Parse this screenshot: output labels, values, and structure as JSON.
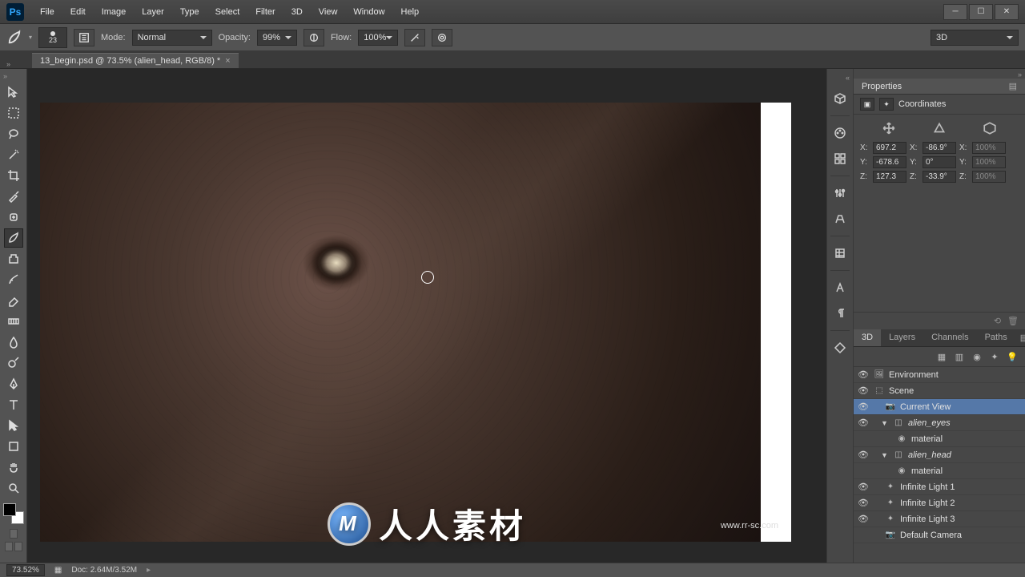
{
  "menubar": [
    "File",
    "Edit",
    "Image",
    "Layer",
    "Type",
    "Select",
    "Filter",
    "3D",
    "View",
    "Window",
    "Help"
  ],
  "logo_text": "Ps",
  "doctab": {
    "title": "13_begin.psd @ 73.5% (alien_head, RGB/8) *"
  },
  "options": {
    "brush_size": "23",
    "mode_label": "Mode:",
    "mode_value": "Normal",
    "opacity_label": "Opacity:",
    "opacity_value": "99%",
    "flow_label": "Flow:",
    "flow_value": "100%",
    "workspace": "3D"
  },
  "properties": {
    "title": "Properties",
    "subtitle": "Coordinates",
    "rows": [
      {
        "l1": "X:",
        "v1": "697.2",
        "l2": "X:",
        "v2": "-86.9°",
        "l3": "X:",
        "v3": "100%"
      },
      {
        "l1": "Y:",
        "v1": "-678.6",
        "l2": "Y:",
        "v2": "0°",
        "l3": "Y:",
        "v3": "100%"
      },
      {
        "l1": "Z:",
        "v1": "127.3",
        "l2": "Z:",
        "v2": "-33.9°",
        "l3": "Z:",
        "v3": "100%"
      }
    ]
  },
  "panel_tabs": [
    "3D",
    "Layers",
    "Channels",
    "Paths"
  ],
  "tree": [
    {
      "label": "Environment",
      "eye": true,
      "icon": "env",
      "indent": 0
    },
    {
      "label": "Scene",
      "eye": true,
      "icon": "scene",
      "indent": 0
    },
    {
      "label": "Current View",
      "eye": true,
      "icon": "camera",
      "indent": 1,
      "selected": true
    },
    {
      "label": "alien_eyes",
      "eye": true,
      "icon": "mesh",
      "indent": 1,
      "italic": true,
      "disclose": "▼"
    },
    {
      "label": "material",
      "eye": false,
      "icon": "mat",
      "indent": 2
    },
    {
      "label": "alien_head",
      "eye": true,
      "icon": "mesh",
      "indent": 1,
      "italic": true,
      "disclose": "▼"
    },
    {
      "label": "material",
      "eye": false,
      "icon": "mat",
      "indent": 2
    },
    {
      "label": "Infinite Light 1",
      "eye": true,
      "icon": "light",
      "indent": 1
    },
    {
      "label": "Infinite Light 2",
      "eye": true,
      "icon": "light",
      "indent": 1
    },
    {
      "label": "Infinite Light 3",
      "eye": true,
      "icon": "light",
      "indent": 1
    },
    {
      "label": "Default Camera",
      "eye": false,
      "icon": "camera",
      "indent": 1
    }
  ],
  "status": {
    "zoom": "73.52%",
    "doc": "Doc: 2.64M/3.52M"
  },
  "watermark": {
    "text": "人人素材",
    "url": "www.rr-sc.com",
    "logo": "M"
  }
}
